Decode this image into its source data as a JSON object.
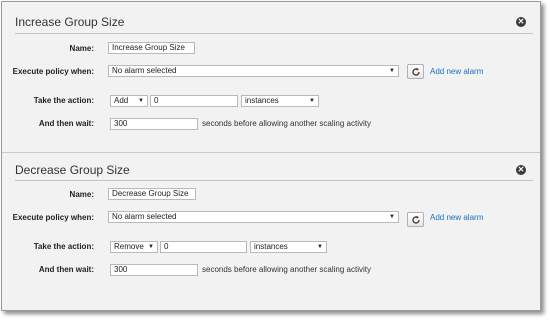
{
  "panels": [
    {
      "title": "Increase Group Size",
      "close_glyph": "✕",
      "name_label": "Name:",
      "name_value": "Increase Group Size",
      "policy_label": "Execute policy when:",
      "policy_selected": "No alarm selected",
      "add_alarm_link": "Add new alarm",
      "action_label": "Take the action:",
      "action_selected": "Add",
      "action_value": "0",
      "unit_selected": "instances",
      "wait_label": "And then wait:",
      "wait_value": "300",
      "wait_suffix": "seconds before allowing another scaling activity"
    },
    {
      "title": "Decrease Group Size",
      "close_glyph": "✕",
      "name_label": "Name:",
      "name_value": "Decrease Group Size",
      "policy_label": "Execute policy when:",
      "policy_selected": "No alarm selected",
      "add_alarm_link": "Add new alarm",
      "action_label": "Take the action:",
      "action_selected": "Remove",
      "action_value": "0",
      "unit_selected": "instances",
      "wait_label": "And then wait:",
      "wait_value": "300",
      "wait_suffix": "seconds before allowing another scaling activity"
    }
  ],
  "icons": {
    "close": "close-icon",
    "refresh": "refresh-icon",
    "dropdown": "chevron-down-icon"
  },
  "colors": {
    "link": "#1a6fc2",
    "background": "#f2f2f2"
  }
}
